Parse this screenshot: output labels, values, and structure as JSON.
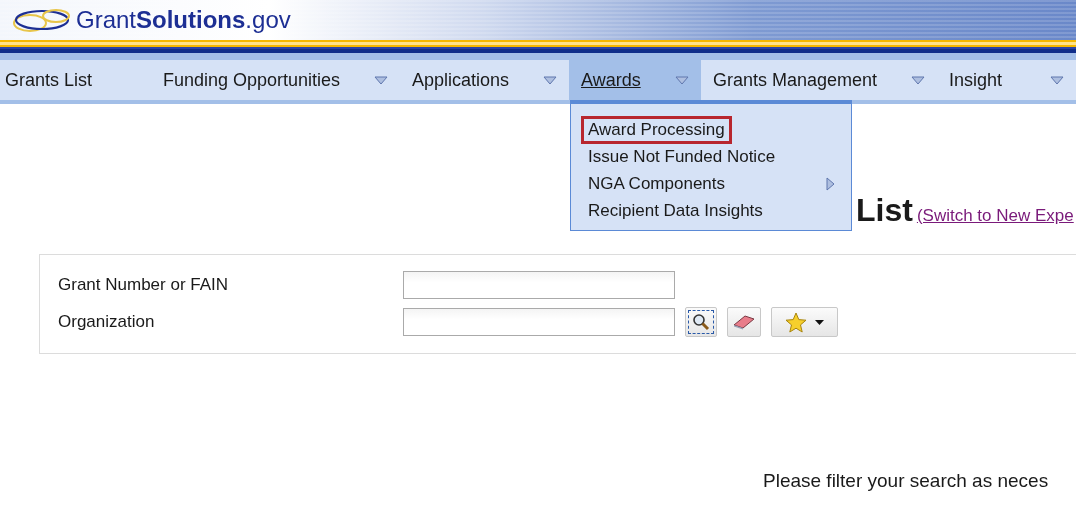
{
  "logo": {
    "text": "Grant**Solutions**.gov"
  },
  "nav": [
    {
      "label": "Grants List",
      "has_menu": false,
      "selected": false
    },
    {
      "label": "Funding Opportunities",
      "has_menu": true,
      "selected": false
    },
    {
      "label": "Applications",
      "has_menu": true,
      "selected": false
    },
    {
      "label": "Awards",
      "has_menu": true,
      "selected": true
    },
    {
      "label": "Grants Management",
      "has_menu": true,
      "selected": false
    },
    {
      "label": "Insight",
      "has_menu": true,
      "selected": false
    }
  ],
  "dropdown": [
    {
      "label": "Award Processing",
      "focused": true,
      "has_submenu": false
    },
    {
      "label": "Issue Not Funded Notice",
      "focused": false,
      "has_submenu": false
    },
    {
      "label": "NGA Components",
      "focused": false,
      "has_submenu": true
    },
    {
      "label": "Recipient Data Insights",
      "focused": false,
      "has_submenu": false
    }
  ],
  "heading": {
    "title": "List",
    "link": "(Switch to New Expe"
  },
  "filters": [
    {
      "label": "Grant Number or FAIN",
      "tools": false
    },
    {
      "label": "Organization",
      "tools": true
    }
  ],
  "message": "Please filter your search as neces"
}
